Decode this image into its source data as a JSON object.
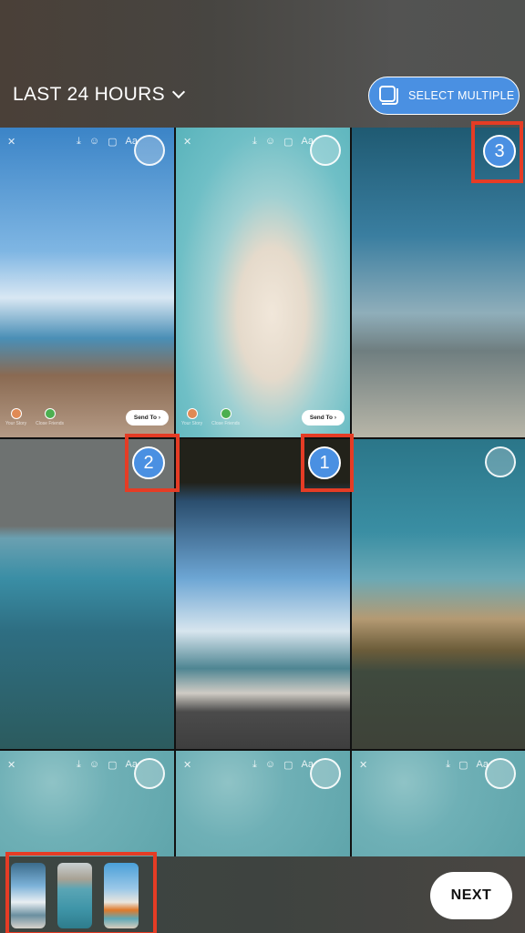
{
  "header": {
    "title": "LAST 24 HOURS",
    "select_multiple_label": "SELECT MULTIPLE"
  },
  "grid": {
    "tiles": [
      {
        "id": "house-pier",
        "selected_order": null,
        "story_ui": true
      },
      {
        "id": "aerial-sandbar",
        "selected_order": null,
        "story_ui": true
      },
      {
        "id": "beach-umbrellas",
        "selected_order": "3",
        "story_ui": false
      },
      {
        "id": "rope-swing",
        "selected_order": "2",
        "story_ui": false
      },
      {
        "id": "palm-hammock",
        "selected_order": "1",
        "story_ui": false
      },
      {
        "id": "grass-sea",
        "selected_order": null,
        "story_ui": false
      },
      {
        "id": "building-water",
        "selected_order": null,
        "story_ui": true
      },
      {
        "id": "water-texture-2",
        "selected_order": null,
        "story_ui": true
      },
      {
        "id": "water-texture-3",
        "selected_order": null,
        "story_ui": true
      }
    ],
    "story_ui": {
      "close": "✕",
      "text_tool": "Aa",
      "your_story": "Your Story",
      "close_friends": "Close Friends",
      "send_to": "Send To ›"
    }
  },
  "bottom": {
    "thumbnails": [
      "palm-hammock",
      "rope-swing",
      "beach-umbrellas"
    ],
    "next_label": "NEXT"
  },
  "colors": {
    "accent": "#4a90e2",
    "highlight": "#e53c25"
  }
}
